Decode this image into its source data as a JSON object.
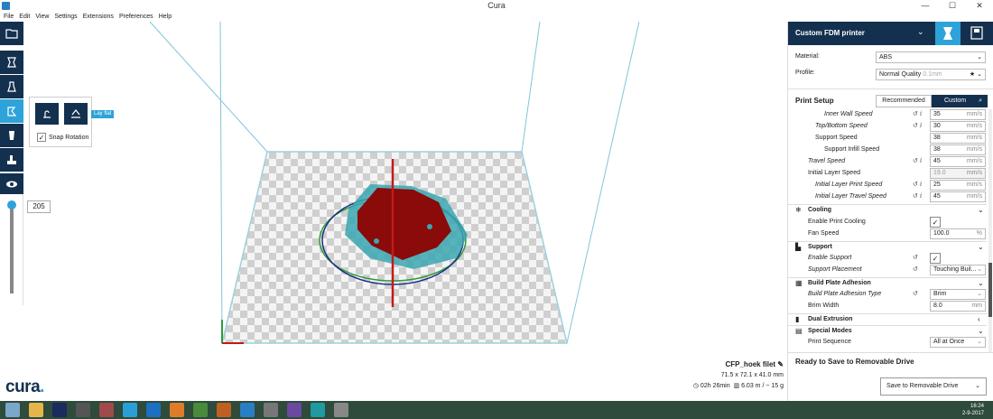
{
  "window": {
    "title": "Cura",
    "min_symbol": "—",
    "max_symbol": "☐",
    "close_symbol": "✕"
  },
  "menu": [
    "File",
    "Edit",
    "View",
    "Settings",
    "Extensions",
    "Preferences",
    "Help"
  ],
  "rotate_popup": {
    "tooltip": "Lay flat",
    "snap_label": "Snap Rotation",
    "snap_checked": true
  },
  "layer_view": {
    "value": "205"
  },
  "logo": {
    "text": "cura",
    "dot": "."
  },
  "job": {
    "name": "CFP_hoek filet",
    "dimensions": "71.5 x 72.1 x 41.0 mm",
    "time": "02h 26min",
    "material": "6.03 m / ~ 15 g"
  },
  "panel": {
    "printer_name": "Custom FDM printer",
    "material_label": "Material:",
    "material_value": "ABS",
    "profile_label": "Profile:",
    "profile_value": "Normal Quality",
    "profile_sub": "0.1mm",
    "print_setup": "Print Setup",
    "recommended": "Recommended",
    "custom": "Custom",
    "ready": "Ready to Save to Removable Drive",
    "save_button": "Save to Removable Drive",
    "settings": [
      {
        "label": "Inner Wall Speed",
        "indent": 40,
        "italic": true,
        "reset": true,
        "value": "35",
        "unit": "mm/s"
      },
      {
        "label": "Top/Bottom Speed",
        "indent": 30,
        "italic": true,
        "reset": true,
        "value": "30",
        "unit": "mm/s"
      },
      {
        "label": "Support Speed",
        "indent": 30,
        "italic": false,
        "reset": false,
        "value": "38",
        "unit": "mm/s"
      },
      {
        "label": "Support Infill Speed",
        "indent": 40,
        "italic": false,
        "reset": false,
        "value": "38",
        "unit": "mm/s"
      },
      {
        "label": "Travel Speed",
        "indent": 22,
        "italic": true,
        "reset": true,
        "value": "45",
        "unit": "mm/s"
      },
      {
        "label": "Initial Layer Speed",
        "indent": 22,
        "italic": false,
        "reset": false,
        "value": "19.0",
        "unit": "mm/s",
        "disabled": true
      },
      {
        "label": "Initial Layer Print Speed",
        "indent": 30,
        "italic": true,
        "reset": true,
        "value": "25",
        "unit": "mm/s"
      },
      {
        "label": "Initial Layer Travel Speed",
        "indent": 30,
        "italic": true,
        "reset": true,
        "value": "45",
        "unit": "mm/s"
      }
    ],
    "cooling": {
      "title": "Cooling",
      "enable_label": "Enable Print Cooling",
      "fan_label": "Fan Speed",
      "fan_value": "100.0",
      "fan_unit": "%"
    },
    "support": {
      "title": "Support",
      "enable_label": "Enable Support",
      "placement_label": "Support Placement",
      "placement_value": "Touching Buil..."
    },
    "adhesion": {
      "title": "Build Plate Adhesion",
      "type_label": "Build Plate Adhesion Type",
      "type_value": "Brim",
      "width_label": "Brim Width",
      "width_value": "8.0",
      "width_unit": "mm"
    },
    "dual": {
      "title": "Dual Extrusion"
    },
    "special": {
      "title": "Special Modes",
      "seq_label": "Print Sequence",
      "seq_value": "All at Once"
    }
  },
  "tray": {
    "time": "16:24",
    "date": "2-9-2017"
  },
  "colors": {
    "accent": "#2da3d9",
    "dark": "#14304f",
    "model": "#8b0a0a",
    "shadow": "#3aa6b0"
  }
}
